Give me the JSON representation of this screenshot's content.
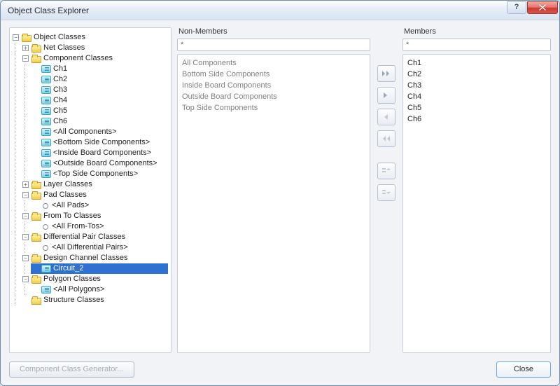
{
  "titlebar": {
    "title": "Object Class Explorer",
    "help_glyph": "?"
  },
  "tree": {
    "root": "Object Classes",
    "net_classes": "Net Classes",
    "component_classes": "Component Classes",
    "components": [
      "Ch1",
      "Ch2",
      "Ch3",
      "Ch4",
      "Ch5",
      "Ch6"
    ],
    "comp_special": [
      "<All Components>",
      "<Bottom Side Components>",
      "<Inside Board Components>",
      "<Outside Board Components>",
      "<Top Side Components>"
    ],
    "layer_classes": "Layer Classes",
    "pad_classes": "Pad Classes",
    "all_pads": "<All Pads>",
    "from_to_classes": "From To Classes",
    "all_from_tos": "<All From-Tos>",
    "diff_pair_classes": "Differential Pair Classes",
    "all_diff_pairs": "<All Differential Pairs>",
    "design_channel_classes": "Design Channel Classes",
    "circuit_2": "Circuit_2",
    "polygon_classes": "Polygon Classes",
    "all_polygons": "<All Polygons>",
    "structure_classes": "Structure Classes"
  },
  "nonmembers": {
    "label": "Non-Members",
    "filter": "*",
    "items": [
      "All Components",
      "Bottom Side Components",
      "Inside Board Components",
      "Outside Board Components",
      "Top Side Components"
    ]
  },
  "members": {
    "label": "Members",
    "filter": "*",
    "items": [
      "Ch1",
      "Ch2",
      "Ch3",
      "Ch4",
      "Ch5",
      "Ch6"
    ]
  },
  "footer": {
    "generator": "Component Class Generator...",
    "close": "Close"
  },
  "glyphs": {
    "minus": "−",
    "plus": "+"
  }
}
